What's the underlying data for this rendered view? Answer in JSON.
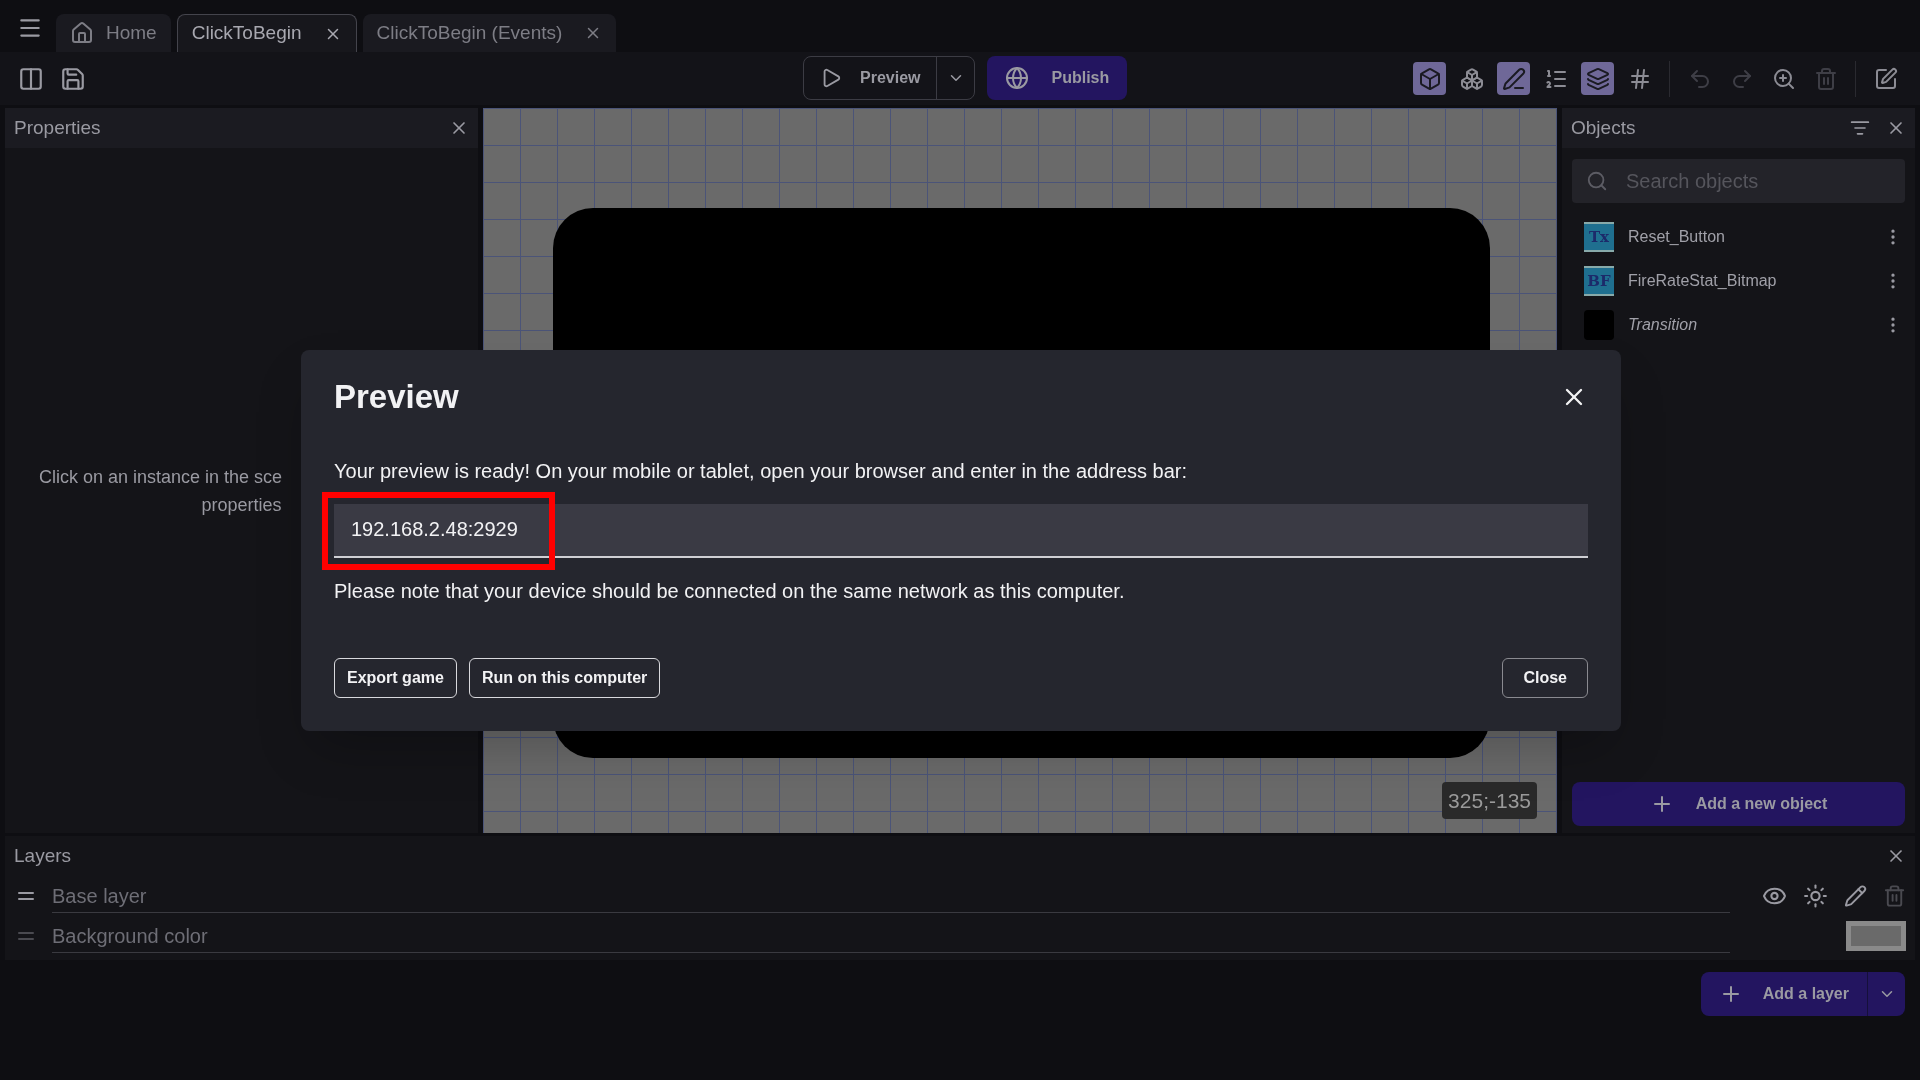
{
  "tabs": [
    {
      "label": "Home",
      "kind": "home",
      "selected": false
    },
    {
      "label": "ClickToBegin",
      "kind": "scene",
      "selected": true
    },
    {
      "label": "ClickToBegin (Events)",
      "kind": "scene",
      "selected": false
    }
  ],
  "toolbar": {
    "preview": "Preview",
    "publish": "Publish",
    "tools": [
      {
        "on": true,
        "disabled": false
      },
      {
        "on": false,
        "disabled": false
      },
      {
        "on": true,
        "disabled": false
      },
      {
        "on": false,
        "disabled": false
      },
      {
        "on": true,
        "disabled": false
      },
      {
        "on": false,
        "disabled": false
      },
      {
        "on": false,
        "disabled": true
      },
      {
        "on": false,
        "disabled": true
      },
      {
        "on": false,
        "disabled": false
      },
      {
        "on": false,
        "disabled": true
      },
      {
        "on": false,
        "disabled": false
      }
    ]
  },
  "properties": {
    "title": "Properties",
    "hint_lines": [
      "Click on an instance in the sce",
      "properties"
    ]
  },
  "canvas": {
    "cursor_position": "325;-135"
  },
  "objects": {
    "title": "Objects",
    "search_placeholder": "Search objects",
    "items": [
      {
        "name": "Reset_Button",
        "kind": "text",
        "icon_label": "Tx",
        "italic": false
      },
      {
        "name": "FireRateStat_Bitmap",
        "kind": "bitmap",
        "icon_label": "BF",
        "italic": false
      },
      {
        "name": "Transition",
        "kind": "solid",
        "italic": true
      }
    ],
    "add_button": "Add a new object"
  },
  "layers": {
    "title": "Layers",
    "rows": [
      {
        "name": "Base layer",
        "kind": "layer"
      },
      {
        "name": "Background color",
        "kind": "background"
      }
    ],
    "add_button": "Add a layer"
  },
  "dialog": {
    "title": "Preview",
    "message": "Your preview is ready! On your mobile or tablet, open your browser and enter in the address bar:",
    "address": "192.168.2.48:2929",
    "note": "Please note that your device should be connected on the same network as this computer.",
    "buttons": [
      "Export game",
      "Run on this computer"
    ],
    "close_button": "Close"
  }
}
